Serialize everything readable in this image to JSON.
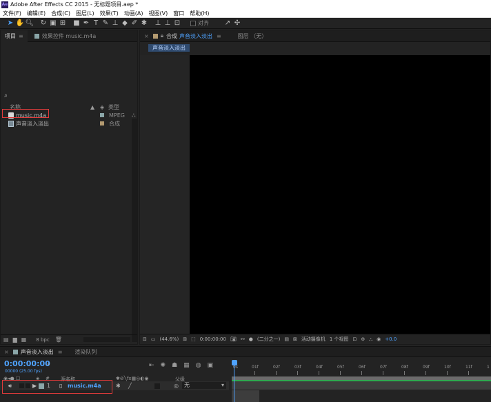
{
  "window": {
    "logo": "Ae",
    "title": "Adobe After Effects CC 2015 - 无标题项目.aep *"
  },
  "menu": [
    "文件(F)",
    "编辑(E)",
    "合成(C)",
    "图层(L)",
    "效果(T)",
    "动画(A)",
    "视图(V)",
    "窗口",
    "帮助(H)"
  ],
  "toolbar": {
    "snap_label": "对齐"
  },
  "project": {
    "tab_project": "项目",
    "tab_effects": "效果控件 music.m4a",
    "menu_glyph": "≡",
    "search_glyph": "⌕",
    "col_name": "名称",
    "col_type": "类型",
    "items": [
      {
        "name": "music.m4a",
        "type": "MPEG",
        "label_color": "#8aa6a8",
        "icon": "audio-file-icon"
      },
      {
        "name": "声音淡入淡出",
        "type": "合成",
        "label_color": "#b39a70",
        "icon": "composition-icon"
      }
    ],
    "bpc": "8 bpc"
  },
  "composition": {
    "tab_prefix": "合成",
    "tab_name": "声音淡入淡出",
    "tab_layer": "图层 （无）",
    "subtab": "声音淡入淡出",
    "footer": {
      "zoom": "(44.6%)",
      "timecode": "0:00:00:00",
      "resolution": "(二分之一)",
      "camera": "活动摄像机",
      "views": "1 个视图",
      "exposure": "+0.0"
    }
  },
  "timeline": {
    "tab_comp": "声音淡入淡出",
    "tab_render": "渲染队列",
    "timecode": "0:00:00:00",
    "fps": "00000 (25.00 fps)",
    "col_hash": "#",
    "col_source": "源名称",
    "col_parent": "父级",
    "ruler": [
      "0s",
      "01f",
      "02f",
      "03f",
      "04f",
      "05f",
      "06f",
      "07f",
      "08f",
      "09f",
      "10f",
      "11f",
      "1"
    ],
    "layer": {
      "index": "1",
      "name": "music.m4a",
      "parent": "无"
    }
  },
  "colors": {
    "accent": "#4fa3ff",
    "highlight": "#e23b3b",
    "audio_bar": "#2fa84f"
  }
}
